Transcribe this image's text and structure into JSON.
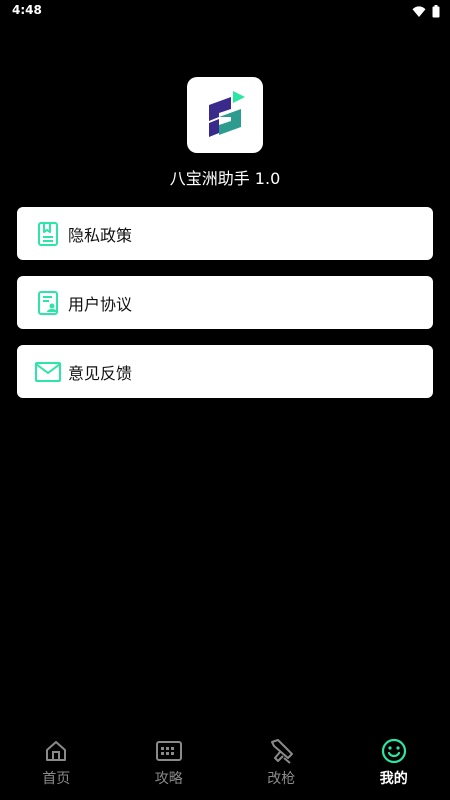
{
  "status_bar": {
    "time": "4:48"
  },
  "app": {
    "name": "八宝洲助手 1.0"
  },
  "menu": {
    "items": [
      {
        "label": "隐私政策",
        "icon": "privacy-policy-icon"
      },
      {
        "label": "用户协议",
        "icon": "user-agreement-icon"
      },
      {
        "label": "意见反馈",
        "icon": "feedback-mail-icon"
      }
    ]
  },
  "tabbar": {
    "tabs": [
      {
        "label": "首页",
        "icon": "home-icon",
        "active": false
      },
      {
        "label": "攻略",
        "icon": "keyboard-icon",
        "active": false
      },
      {
        "label": "改枪",
        "icon": "gun-icon",
        "active": false
      },
      {
        "label": "我的",
        "icon": "smiley-icon",
        "active": true
      }
    ]
  },
  "colors": {
    "background": "#000000",
    "accent": "#2de5a4",
    "card": "#ffffff",
    "inactive": "#8a8a8a"
  }
}
